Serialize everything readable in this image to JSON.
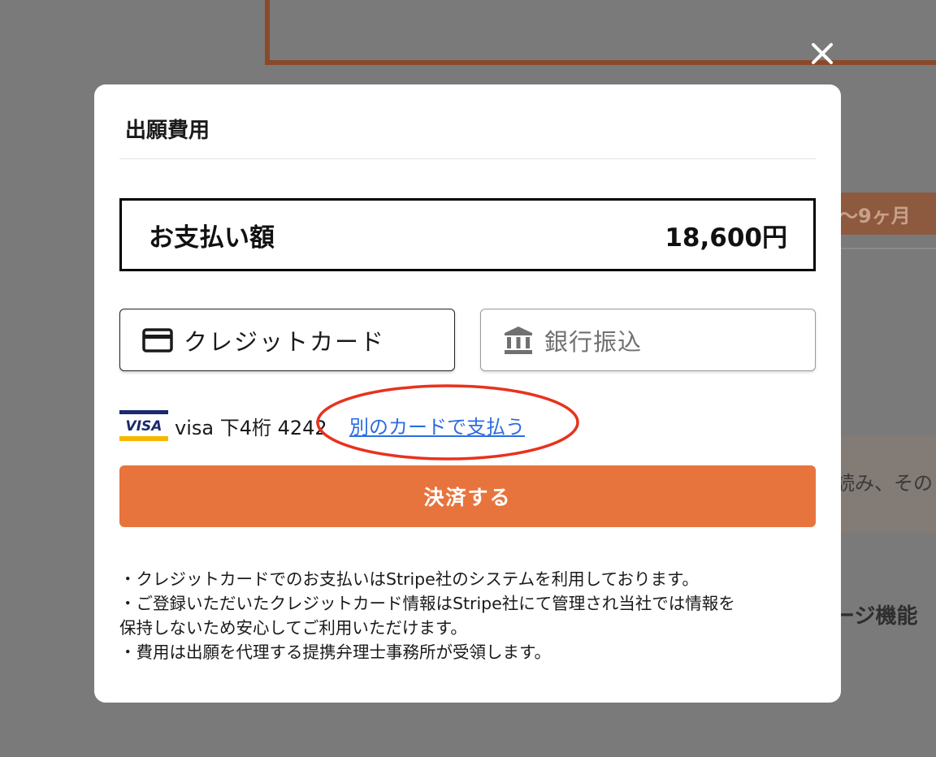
{
  "background": {
    "tag_text": "〜9ヶ月",
    "text_fragment_1": "読み、その",
    "text_fragment_2": "ージ機能"
  },
  "modal": {
    "title": "出願費用",
    "close_icon": "close-icon",
    "amount": {
      "label": "お支払い額",
      "value": "18,600円"
    },
    "methods": {
      "card": {
        "label": "クレジットカード",
        "icon": "credit-card-icon"
      },
      "bank": {
        "label": "銀行振込",
        "icon": "bank-icon"
      }
    },
    "saved_card": {
      "brand_logo": "VISA",
      "info": "visa 下4桁 4242",
      "other_card_link": "別のカードで支払う"
    },
    "pay_button": "決済する",
    "notes": [
      "・クレジットカードでのお支払いはStripe社のシステムを利用しております。",
      "・ご登録いただいたクレジットカード情報はStripe社にて管理され当社では情報を",
      "保持しないため安心してご利用いただけます。",
      "・費用は出願を代理する提携弁理士事務所が受領します。"
    ]
  },
  "colors": {
    "overlay": "#7a7a7a",
    "accent": "#e8743d",
    "link": "#2c6de0",
    "annotation": "#e8321e"
  }
}
